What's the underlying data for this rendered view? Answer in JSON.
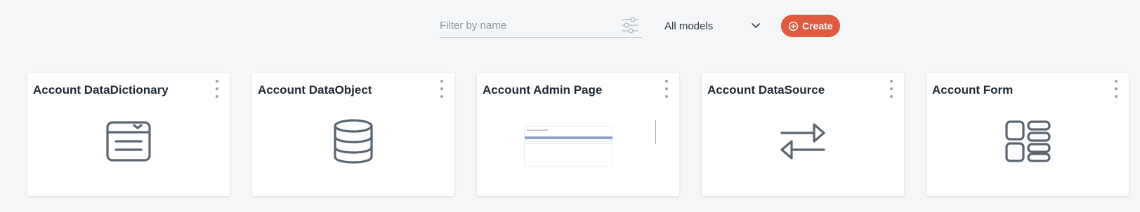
{
  "toolbar": {
    "filter": {
      "placeholder": "Filter by name",
      "value": "",
      "icon": "tune-icon"
    },
    "model_select": {
      "selected": "All models",
      "icon": "chevron-down-icon"
    },
    "create_button": {
      "label": "Create",
      "icon": "plus-circle-icon",
      "color": "#e05a3f"
    }
  },
  "cards": [
    {
      "title": "Account DataDictionary",
      "icon": "data-dictionary-icon"
    },
    {
      "title": "Account DataObject",
      "icon": "database-icon"
    },
    {
      "title": "Account Admin Page",
      "icon": "page-thumbnail"
    },
    {
      "title": "Account DataSource",
      "icon": "transfer-arrows-icon"
    },
    {
      "title": "Account Form",
      "icon": "form-layout-icon"
    }
  ],
  "colors": {
    "background": "#f5f6f8",
    "card": "#ffffff",
    "icon": "#5a6570",
    "accent": "#e05a3f"
  }
}
